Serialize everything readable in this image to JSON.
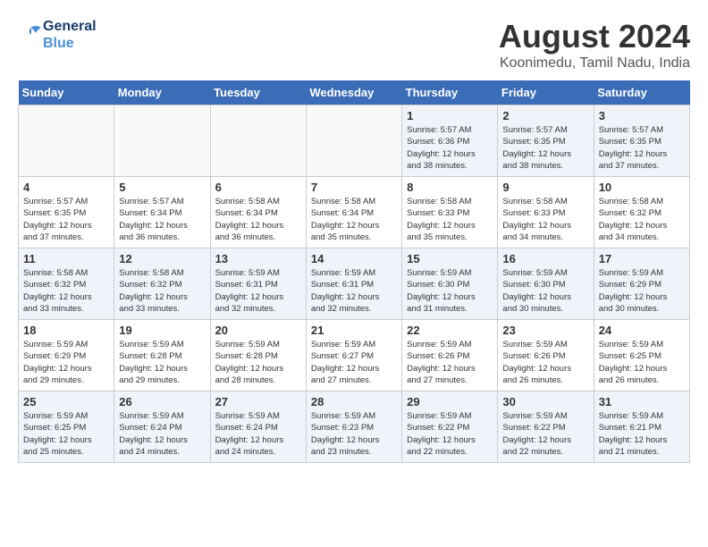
{
  "header": {
    "logo_line1": "General",
    "logo_line2": "Blue",
    "title": "August 2024",
    "subtitle": "Koonimedu, Tamil Nadu, India"
  },
  "days_of_week": [
    "Sunday",
    "Monday",
    "Tuesday",
    "Wednesday",
    "Thursday",
    "Friday",
    "Saturday"
  ],
  "weeks": [
    [
      {
        "day": "",
        "info": ""
      },
      {
        "day": "",
        "info": ""
      },
      {
        "day": "",
        "info": ""
      },
      {
        "day": "",
        "info": ""
      },
      {
        "day": "1",
        "info": "Sunrise: 5:57 AM\nSunset: 6:36 PM\nDaylight: 12 hours\nand 38 minutes."
      },
      {
        "day": "2",
        "info": "Sunrise: 5:57 AM\nSunset: 6:35 PM\nDaylight: 12 hours\nand 38 minutes."
      },
      {
        "day": "3",
        "info": "Sunrise: 5:57 AM\nSunset: 6:35 PM\nDaylight: 12 hours\nand 37 minutes."
      }
    ],
    [
      {
        "day": "4",
        "info": "Sunrise: 5:57 AM\nSunset: 6:35 PM\nDaylight: 12 hours\nand 37 minutes."
      },
      {
        "day": "5",
        "info": "Sunrise: 5:57 AM\nSunset: 6:34 PM\nDaylight: 12 hours\nand 36 minutes."
      },
      {
        "day": "6",
        "info": "Sunrise: 5:58 AM\nSunset: 6:34 PM\nDaylight: 12 hours\nand 36 minutes."
      },
      {
        "day": "7",
        "info": "Sunrise: 5:58 AM\nSunset: 6:34 PM\nDaylight: 12 hours\nand 35 minutes."
      },
      {
        "day": "8",
        "info": "Sunrise: 5:58 AM\nSunset: 6:33 PM\nDaylight: 12 hours\nand 35 minutes."
      },
      {
        "day": "9",
        "info": "Sunrise: 5:58 AM\nSunset: 6:33 PM\nDaylight: 12 hours\nand 34 minutes."
      },
      {
        "day": "10",
        "info": "Sunrise: 5:58 AM\nSunset: 6:32 PM\nDaylight: 12 hours\nand 34 minutes."
      }
    ],
    [
      {
        "day": "11",
        "info": "Sunrise: 5:58 AM\nSunset: 6:32 PM\nDaylight: 12 hours\nand 33 minutes."
      },
      {
        "day": "12",
        "info": "Sunrise: 5:58 AM\nSunset: 6:32 PM\nDaylight: 12 hours\nand 33 minutes."
      },
      {
        "day": "13",
        "info": "Sunrise: 5:59 AM\nSunset: 6:31 PM\nDaylight: 12 hours\nand 32 minutes."
      },
      {
        "day": "14",
        "info": "Sunrise: 5:59 AM\nSunset: 6:31 PM\nDaylight: 12 hours\nand 32 minutes."
      },
      {
        "day": "15",
        "info": "Sunrise: 5:59 AM\nSunset: 6:30 PM\nDaylight: 12 hours\nand 31 minutes."
      },
      {
        "day": "16",
        "info": "Sunrise: 5:59 AM\nSunset: 6:30 PM\nDaylight: 12 hours\nand 30 minutes."
      },
      {
        "day": "17",
        "info": "Sunrise: 5:59 AM\nSunset: 6:29 PM\nDaylight: 12 hours\nand 30 minutes."
      }
    ],
    [
      {
        "day": "18",
        "info": "Sunrise: 5:59 AM\nSunset: 6:29 PM\nDaylight: 12 hours\nand 29 minutes."
      },
      {
        "day": "19",
        "info": "Sunrise: 5:59 AM\nSunset: 6:28 PM\nDaylight: 12 hours\nand 29 minutes."
      },
      {
        "day": "20",
        "info": "Sunrise: 5:59 AM\nSunset: 6:28 PM\nDaylight: 12 hours\nand 28 minutes."
      },
      {
        "day": "21",
        "info": "Sunrise: 5:59 AM\nSunset: 6:27 PM\nDaylight: 12 hours\nand 27 minutes."
      },
      {
        "day": "22",
        "info": "Sunrise: 5:59 AM\nSunset: 6:26 PM\nDaylight: 12 hours\nand 27 minutes."
      },
      {
        "day": "23",
        "info": "Sunrise: 5:59 AM\nSunset: 6:26 PM\nDaylight: 12 hours\nand 26 minutes."
      },
      {
        "day": "24",
        "info": "Sunrise: 5:59 AM\nSunset: 6:25 PM\nDaylight: 12 hours\nand 26 minutes."
      }
    ],
    [
      {
        "day": "25",
        "info": "Sunrise: 5:59 AM\nSunset: 6:25 PM\nDaylight: 12 hours\nand 25 minutes."
      },
      {
        "day": "26",
        "info": "Sunrise: 5:59 AM\nSunset: 6:24 PM\nDaylight: 12 hours\nand 24 minutes."
      },
      {
        "day": "27",
        "info": "Sunrise: 5:59 AM\nSunset: 6:24 PM\nDaylight: 12 hours\nand 24 minutes."
      },
      {
        "day": "28",
        "info": "Sunrise: 5:59 AM\nSunset: 6:23 PM\nDaylight: 12 hours\nand 23 minutes."
      },
      {
        "day": "29",
        "info": "Sunrise: 5:59 AM\nSunset: 6:22 PM\nDaylight: 12 hours\nand 22 minutes."
      },
      {
        "day": "30",
        "info": "Sunrise: 5:59 AM\nSunset: 6:22 PM\nDaylight: 12 hours\nand 22 minutes."
      },
      {
        "day": "31",
        "info": "Sunrise: 5:59 AM\nSunset: 6:21 PM\nDaylight: 12 hours\nand 21 minutes."
      }
    ]
  ]
}
